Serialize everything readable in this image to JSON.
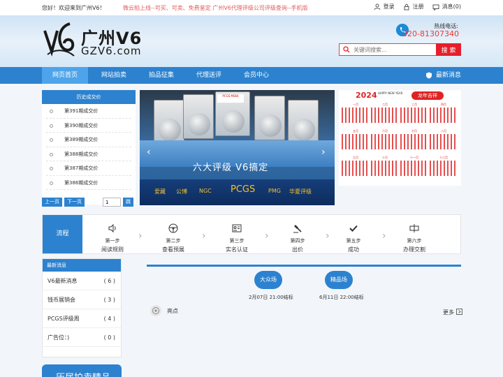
{
  "topbar": {
    "welcome": "您好！欢迎来到广州V6！",
    "promo": "微云拍上线--可买、可卖、免费鉴定    广州V6代理评级公司评级查询--手机版",
    "login": "登录",
    "register": "注册",
    "messages": "消息(0)"
  },
  "header": {
    "logo_cn": "广州V6",
    "logo_en": "GZV6.com",
    "hotline_label": "热线电话:",
    "hotline_number": "020-81307340",
    "search_placeholder": "关键词搜索...",
    "search_button": "搜 索"
  },
  "nav": {
    "items": [
      {
        "label": "网页首页"
      },
      {
        "label": "网站拍卖"
      },
      {
        "label": "拍品征集"
      },
      {
        "label": "代理送评"
      },
      {
        "label": "会员中心"
      }
    ],
    "news_label": "最新消息"
  },
  "history": {
    "title": "历史成交价",
    "items": [
      "第391期成交价",
      "第390期成交价",
      "第389期成交价",
      "第388期成交价",
      "第387期成交价",
      "第386期成交价"
    ],
    "prev": "上一页",
    "next": "下一页",
    "page_value": "1",
    "go": "跳"
  },
  "banner": {
    "slogan": "六大评级  V6搞定",
    "brands": [
      "爱藏",
      "公博",
      "NGC",
      "PCGS",
      "PMG",
      "华夏评级"
    ],
    "slab_label": "PCGS MS64"
  },
  "calendar": {
    "title": "2024",
    "subtitle": "HAPPY NEW YEAR",
    "year_badge": "龙年吉祥",
    "months": [
      "一月",
      "二月",
      "三月",
      "四月",
      "五月",
      "六月",
      "七月",
      "八月",
      "九月",
      "十月",
      "十一月",
      "十二月"
    ]
  },
  "process": {
    "label": "流程",
    "steps": [
      {
        "step": "第一步",
        "name": "阅读规则",
        "icon": "speaker-icon"
      },
      {
        "step": "第二步",
        "name": "查看预展",
        "icon": "steering-icon"
      },
      {
        "step": "第三步",
        "name": "实名认证",
        "icon": "id-card-icon"
      },
      {
        "step": "第四步",
        "name": "出价",
        "icon": "gavel-icon"
      },
      {
        "step": "第五步",
        "name": "成功",
        "icon": "check-icon"
      },
      {
        "step": "第六步",
        "name": "办理交割",
        "icon": "handover-icon"
      }
    ]
  },
  "news": {
    "title": "最新消息",
    "items": [
      {
        "label": "V6最新消息",
        "count": "( 6 )"
      },
      {
        "label": "钱币展销会",
        "count": "( 3 )"
      },
      {
        "label": "PCGS评级周",
        "count": "( 4 )"
      },
      {
        "label": "广告位：)",
        "count": "( 0 )"
      }
    ]
  },
  "history_box": "历届拍卖精品",
  "auctions": {
    "sessions": [
      {
        "name": "大众场",
        "time": "2月07日 21:00结标"
      },
      {
        "name": "精品场",
        "time": "6月11日 22:00结标"
      }
    ],
    "highlights": "亮点",
    "more": "更多"
  },
  "colors": {
    "primary": "#2c82cf",
    "accent": "#e41f2b"
  }
}
